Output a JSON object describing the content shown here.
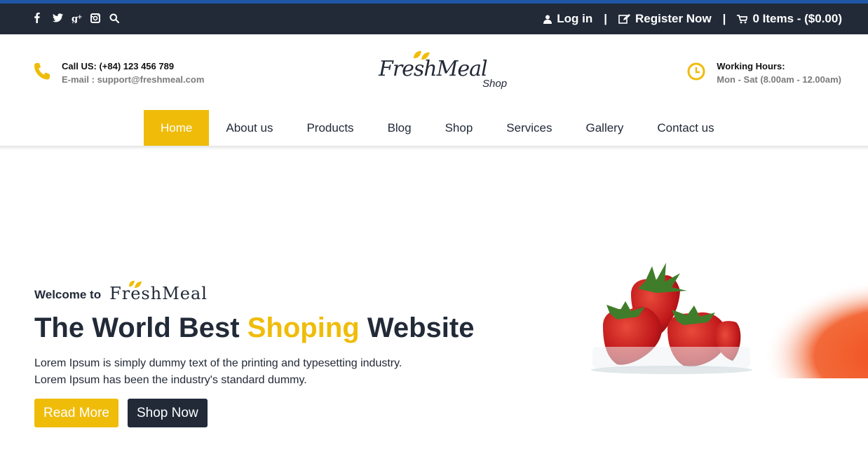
{
  "topbar": {
    "social": [
      {
        "icon": "facebook-icon",
        "glyph": "f"
      },
      {
        "icon": "twitter-icon",
        "glyph": "t"
      },
      {
        "icon": "google-plus-icon",
        "glyph": "g+"
      },
      {
        "icon": "instagram-icon",
        "glyph": "ig"
      },
      {
        "icon": "search-icon",
        "glyph": "search"
      }
    ],
    "login_label": "Log in",
    "separator": "|",
    "register_label": "Register Now",
    "cart_label": "0 Items - ($0.00)"
  },
  "header": {
    "call_label": "Call US: (+84) 123 456 789",
    "email_label": "E-mail : support@freshmeal.com",
    "logo_text": "FreshMeal",
    "logo_sub": "Shop",
    "hours_title": "Working Hours:",
    "hours_value": "Mon - Sat (8.00am - 12.00am)"
  },
  "nav": {
    "items": [
      {
        "label": "Home",
        "active": true
      },
      {
        "label": "About us"
      },
      {
        "label": "Products"
      },
      {
        "label": "Blog"
      },
      {
        "label": "Shop"
      },
      {
        "label": "Services"
      },
      {
        "label": "Gallery"
      },
      {
        "label": "Contact us"
      }
    ]
  },
  "hero": {
    "welcome": "Welcome to",
    "brand": "FreshMeal",
    "title_pre": "The World Best ",
    "title_highlight": "Shoping",
    "title_post": " Website",
    "desc_line1": "Lorem Ipsum is simply dummy text of the printing and typesetting industry.",
    "desc_line2": "Lorem Ipsum has been the industry's standard dummy.",
    "read_more": "Read More",
    "shop_now": "Shop Now"
  },
  "colors": {
    "accent": "#efbc0a",
    "dark": "#222a38",
    "top_stripe": "#1f56a6"
  }
}
